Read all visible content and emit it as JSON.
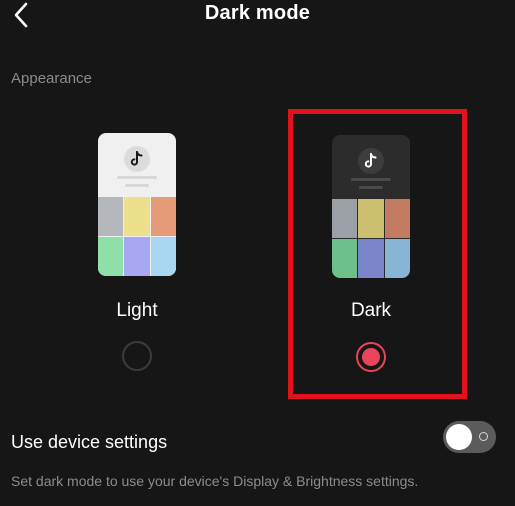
{
  "header": {
    "title": "Dark mode",
    "back_icon": "chevron-left-icon"
  },
  "appearance": {
    "section_label": "Appearance",
    "options": [
      {
        "label": "Light",
        "selected": false,
        "tile_colors": [
          "#b4b8bd",
          "#ece08c",
          "#e69b78",
          "#8fe0a6",
          "#a8a8f2",
          "#a8d6f0"
        ]
      },
      {
        "label": "Dark",
        "selected": true,
        "tile_colors": [
          "#9ba0a6",
          "#cdbf70",
          "#c27c62",
          "#6ec08a",
          "#7b84c8",
          "#88b4d6"
        ]
      }
    ],
    "accent_color": "#e8445a",
    "highlight_color": "#e0131d"
  },
  "device_settings": {
    "label": "Use device settings",
    "enabled": false,
    "description": "Set dark mode to use your device's Display & Brightness settings."
  }
}
